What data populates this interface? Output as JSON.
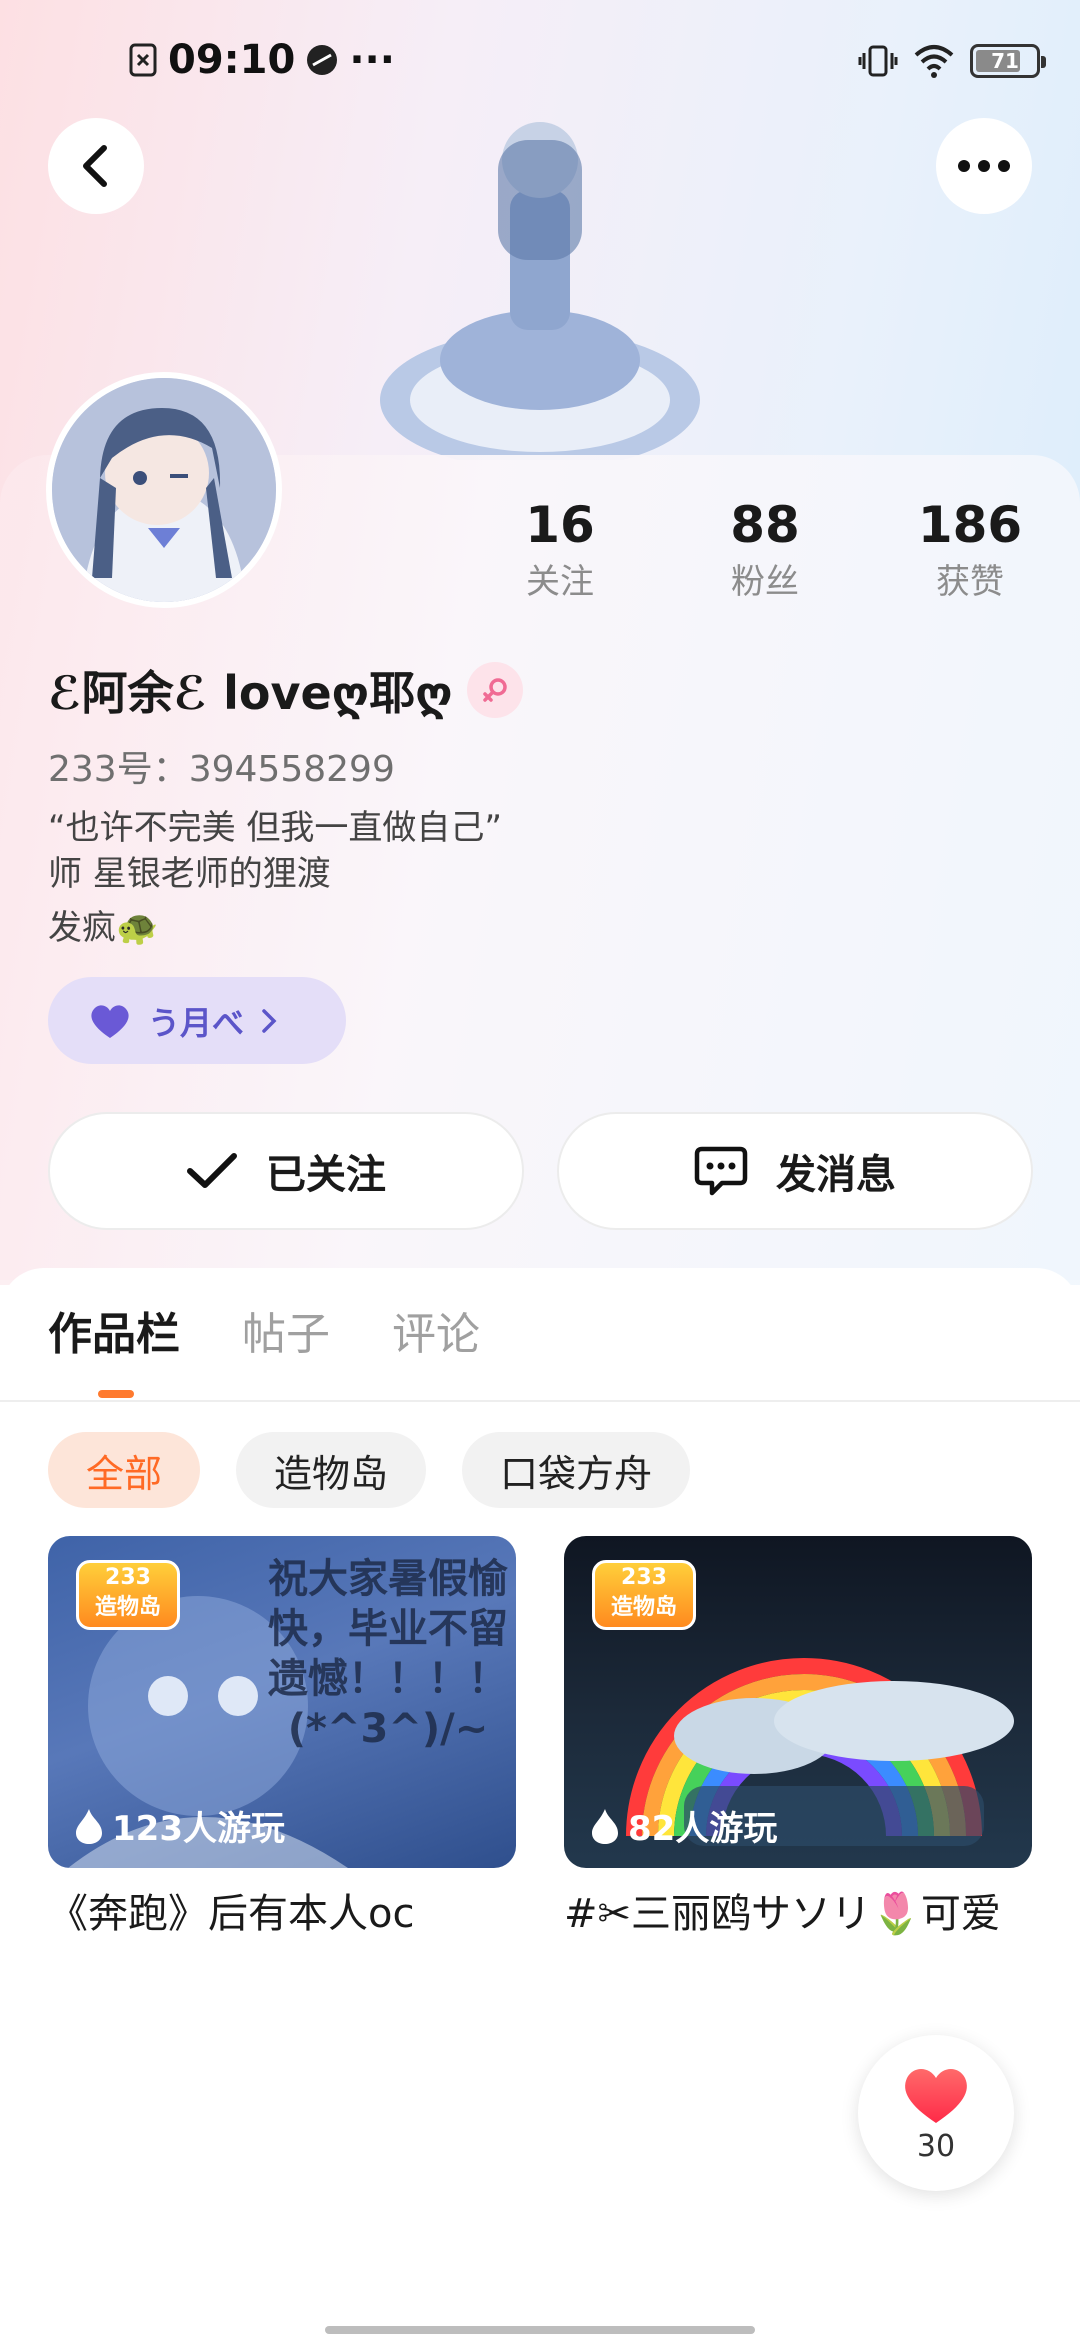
{
  "status_bar": {
    "time": "09:10",
    "dots": "···",
    "battery": "71"
  },
  "profile": {
    "stats": [
      {
        "value": "16",
        "label": "关注"
      },
      {
        "value": "88",
        "label": "粉丝"
      },
      {
        "value": "186",
        "label": "获赞"
      }
    ],
    "nickname": "ℰ阿余ℰ loveღ耶ღ",
    "uid": "233号：394558299",
    "bio_line1": "“也许不完美 但我一直做自己”",
    "bio_line2": "师 星银老师的狸渡",
    "bio_line3": "发疯🐢",
    "tag": "う月べ",
    "follow_label": "已关注",
    "message_label": "发消息"
  },
  "tabs": [
    {
      "label": "作品栏",
      "active": true
    },
    {
      "label": "帖子",
      "active": false
    },
    {
      "label": "评论",
      "active": false
    }
  ],
  "filters": [
    {
      "label": "全部",
      "active": true
    },
    {
      "label": "造物岛",
      "active": false
    },
    {
      "label": "口袋方舟",
      "active": false
    }
  ],
  "works": [
    {
      "logo_top": "233",
      "logo_bottom": "造物岛",
      "plays": "123人游玩",
      "overlay": "祝大家暑假愉快，毕业不留遗憾！！！！(*^3^)/~",
      "title": "《奔跑》后有本人oc"
    },
    {
      "logo_top": "233",
      "logo_bottom": "造物岛",
      "plays": "82人游玩",
      "title": "#✂三丽鸥サソリ🌷可爱"
    }
  ],
  "like_button": {
    "count": "30"
  },
  "colors": {
    "accent": "#ff7a2e",
    "tag_bg": "#e4def8",
    "tag_text": "#5b55c9",
    "like_red": "#ff3b4e"
  }
}
